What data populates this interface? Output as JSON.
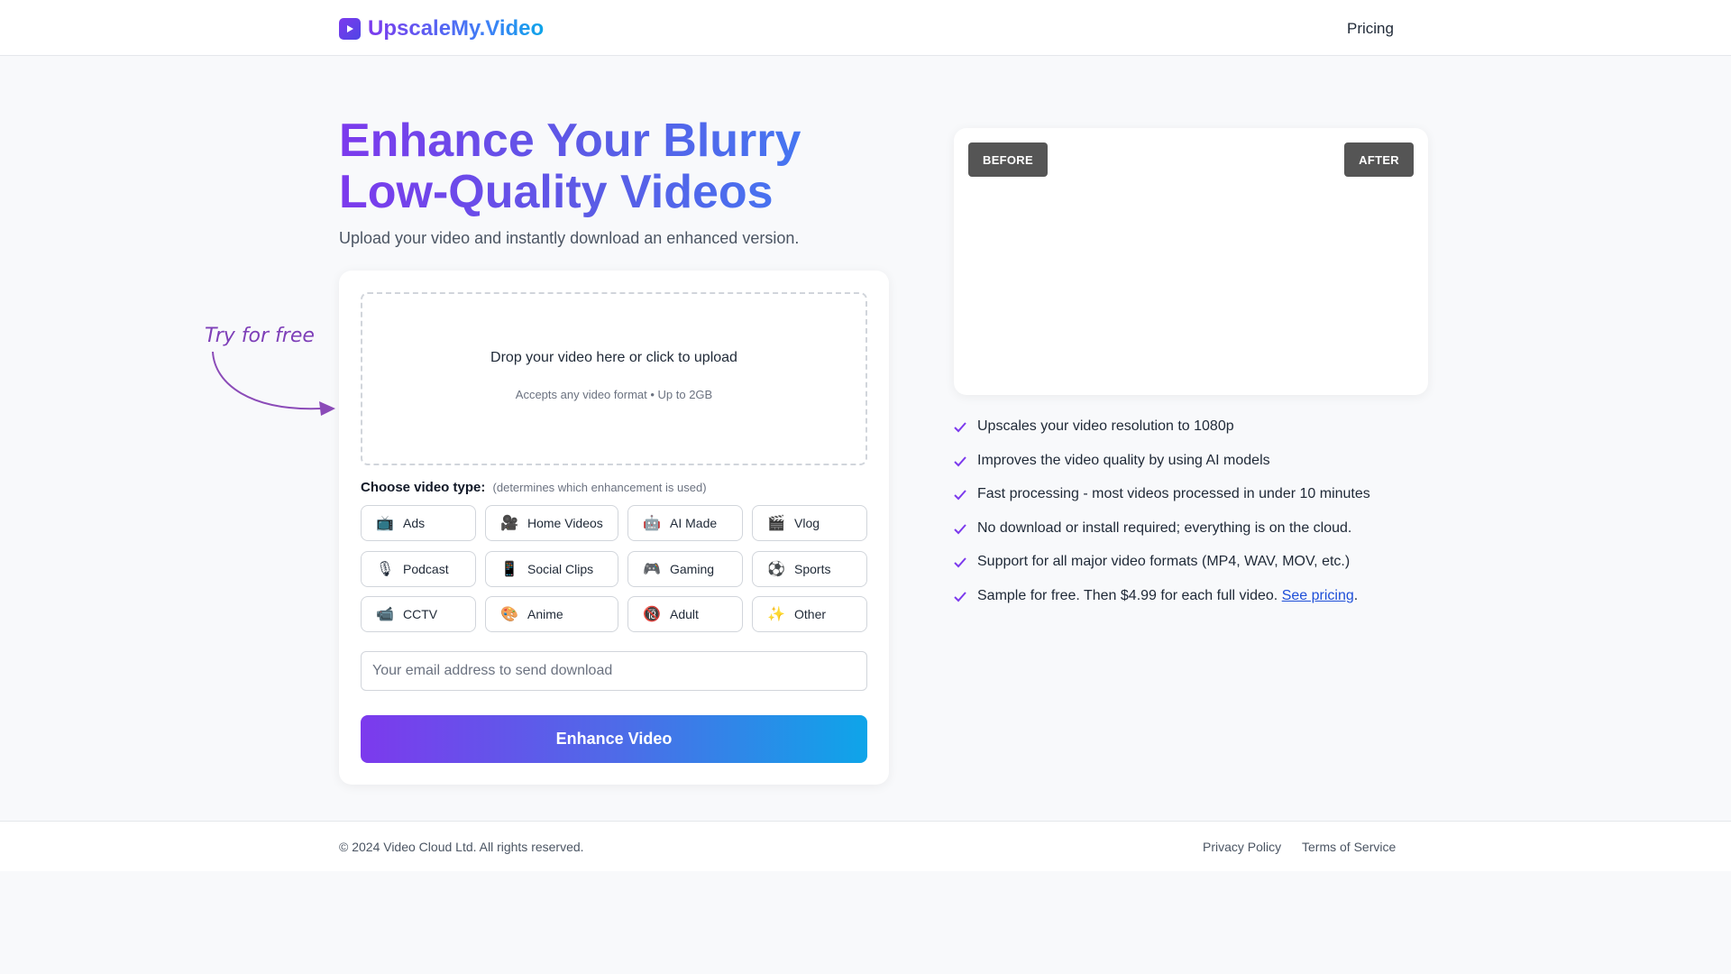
{
  "header": {
    "brand": "UpscaleMy.Video",
    "logo_icon": "play-icon",
    "nav": {
      "pricing": "Pricing"
    }
  },
  "hero": {
    "title_line1": "Enhance Your Blurry",
    "title_line2": "Low-Quality Videos",
    "subtitle": "Upload your video and instantly download an enhanced version."
  },
  "annotation": {
    "text": "Try for free"
  },
  "upload": {
    "drop_text": "Drop your video here or click to upload",
    "drop_hint": "Accepts any video format • Up to 2GB",
    "type_label": "Choose video type:",
    "type_hint": "(determines which enhancement is used)",
    "video_types": [
      {
        "label": "Ads",
        "icon": "📺"
      },
      {
        "label": "Home Videos",
        "icon": "🎥"
      },
      {
        "label": "AI Made",
        "icon": "🤖"
      },
      {
        "label": "Vlog",
        "icon": "🎬"
      },
      {
        "label": "Podcast",
        "icon": "🎙"
      },
      {
        "label": "Social Clips",
        "icon": "📱"
      },
      {
        "label": "Gaming",
        "icon": "🎮"
      },
      {
        "label": "Sports",
        "icon": "⚽"
      },
      {
        "label": "CCTV",
        "icon": "📹"
      },
      {
        "label": "Anime",
        "icon": "🎨"
      },
      {
        "label": "Adult",
        "icon": "🔞"
      },
      {
        "label": "Other",
        "icon": "✨"
      }
    ],
    "email_placeholder": "Your email address to send download",
    "submit_label": "Enhance Video"
  },
  "preview": {
    "before_label": "BEFORE",
    "after_label": "AFTER"
  },
  "features": [
    "Upscales your video resolution to 1080p",
    "Improves the video quality by using AI models",
    "Fast processing - most videos processed in under 10 minutes",
    "No download or install required; everything is on the cloud.",
    "Support for all major video formats (MP4, WAV, MOV, etc.)"
  ],
  "pricing_feature": {
    "text": "Sample for free. Then $4.99 for each full video.",
    "link": "See pricing",
    "suffix": "."
  },
  "footer": {
    "copyright": "© 2024 Video Cloud Ltd. All rights reserved.",
    "privacy": "Privacy Policy",
    "terms": "Terms of Service"
  },
  "colors": {
    "accent_purple": "#7c3aed",
    "accent_blue": "#3b82f6",
    "accent_cyan": "#0ea5e9",
    "badge_bg": "#555555"
  }
}
